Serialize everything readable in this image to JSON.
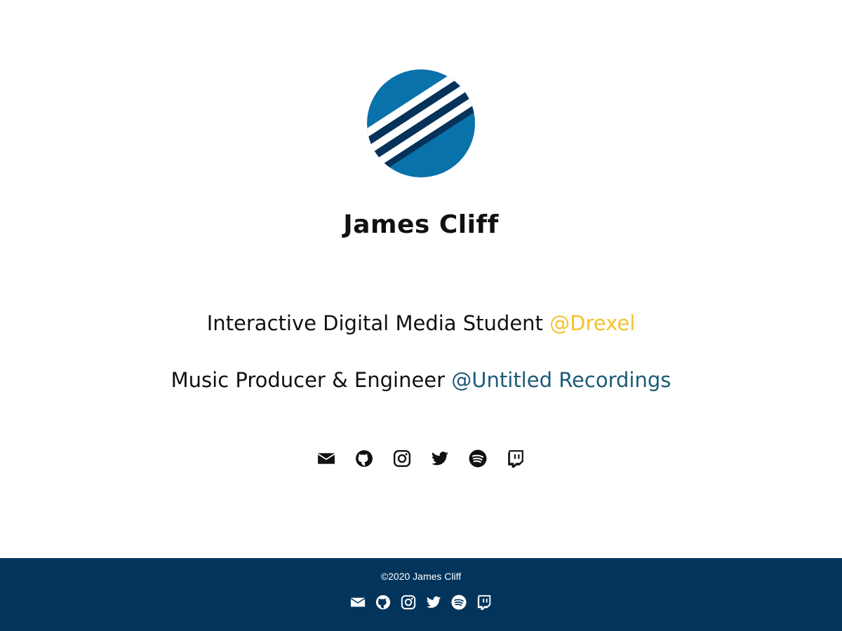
{
  "profile": {
    "name": "James Cliff",
    "logo_icon": "striped-globe-logo"
  },
  "taglines": [
    {
      "text": "Interactive Digital Media Student ",
      "link": "@Drexel",
      "link_color": "#f3c32b"
    },
    {
      "text": "Music Producer & Engineer ",
      "link": "@Untitled Recordings",
      "link_color": "#1b5a78"
    }
  ],
  "social_icons": [
    "envelope-icon",
    "github-icon",
    "instagram-icon",
    "twitter-icon",
    "spotify-icon",
    "twitch-icon"
  ],
  "footer": {
    "copyright": "©2020 James Cliff",
    "background": "#03355c"
  },
  "colors": {
    "logo_blue": "#0a72aa",
    "logo_navy": "#06325a",
    "text": "#111111"
  }
}
